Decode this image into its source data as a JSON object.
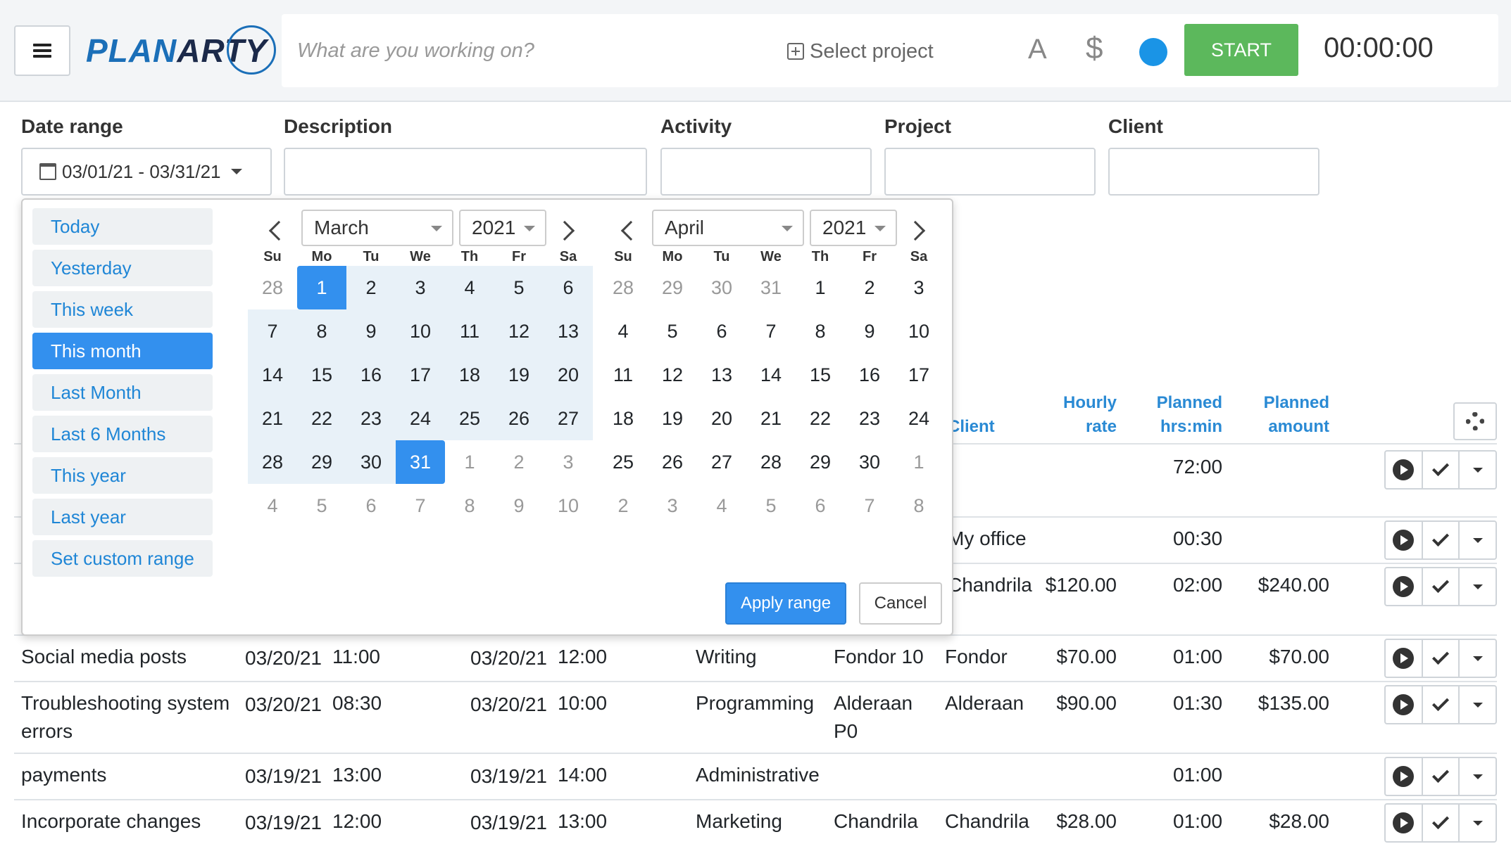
{
  "header": {
    "logo_text_1": "PLAN",
    "logo_text_2": "ARTY",
    "description_placeholder": "What are you working on?",
    "select_project": "Select project",
    "tag_icon": "A",
    "billable_icon": "$",
    "start_label": "START",
    "timer": "00:00:00"
  },
  "filters": {
    "date_range_label": "Date range",
    "date_range_value": "03/01/21 - 03/31/21",
    "description_label": "Description",
    "activity_label": "Activity",
    "project_label": "Project",
    "client_label": "Client"
  },
  "picker": {
    "ranges": [
      "Today",
      "Yesterday",
      "This week",
      "This month",
      "Last Month",
      "Last 6 Months",
      "This year",
      "Last year",
      "Set custom range"
    ],
    "active_range": "This month",
    "left_month": "March",
    "left_year": "2021",
    "right_month": "April",
    "right_year": "2021",
    "weekdays": [
      "Su",
      "Mo",
      "Tu",
      "We",
      "Th",
      "Fr",
      "Sa"
    ],
    "left_days": [
      "28",
      "1",
      "2",
      "3",
      "4",
      "5",
      "6",
      "7",
      "8",
      "9",
      "10",
      "11",
      "12",
      "13",
      "14",
      "15",
      "16",
      "17",
      "18",
      "19",
      "20",
      "21",
      "22",
      "23",
      "24",
      "25",
      "26",
      "27",
      "28",
      "29",
      "30",
      "31",
      "1",
      "2",
      "3",
      "4",
      "5",
      "6",
      "7",
      "8",
      "9",
      "10"
    ],
    "right_days": [
      "28",
      "29",
      "30",
      "31",
      "1",
      "2",
      "3",
      "4",
      "5",
      "6",
      "7",
      "8",
      "9",
      "10",
      "11",
      "12",
      "13",
      "14",
      "15",
      "16",
      "17",
      "18",
      "19",
      "20",
      "21",
      "22",
      "23",
      "24",
      "25",
      "26",
      "27",
      "28",
      "29",
      "30",
      "1",
      "2",
      "3",
      "4",
      "5",
      "6",
      "7",
      "8"
    ],
    "apply_label": "Apply range",
    "cancel_label": "Cancel"
  },
  "table": {
    "headers": {
      "client": "Client",
      "hourly_rate_1": "Hourly",
      "hourly_rate_2": "rate",
      "planned_hrs_1": "Planned",
      "planned_hrs_2": "hrs:min",
      "planned_amount_1": "Planned",
      "planned_amount_2": "amount"
    },
    "partial_rows": [
      {
        "client": "",
        "rate": "",
        "hrs": "72:00",
        "amount": ""
      },
      {
        "client": "My office",
        "rate": "",
        "hrs": "00:30",
        "amount": ""
      },
      {
        "client": "Chandrila",
        "rate": "$120.00",
        "hrs": "02:00",
        "amount": "$240.00"
      }
    ],
    "rows": [
      {
        "description": "Social media posts",
        "start_date": "03/20/21",
        "start_time": "11:00",
        "end_date": "03/20/21",
        "end_time": "12:00",
        "activity": "Writing",
        "project": "Fondor 10",
        "client": "Fondor",
        "rate": "$70.00",
        "hrs": "01:00",
        "amount": "$70.00"
      },
      {
        "description": "Troubleshooting system",
        "description_2": "errors",
        "start_date": "03/20/21",
        "start_time": "08:30",
        "end_date": "03/20/21",
        "end_time": "10:00",
        "activity": "Programming",
        "project": "Alderaan",
        "project_2": "P0",
        "client": "Alderaan",
        "rate": "$90.00",
        "hrs": "01:30",
        "amount": "$135.00"
      },
      {
        "description": "payments",
        "start_date": "03/19/21",
        "start_time": "13:00",
        "end_date": "03/19/21",
        "end_time": "14:00",
        "activity": "Administrative",
        "project": "",
        "client": "",
        "rate": "",
        "hrs": "01:00",
        "amount": ""
      },
      {
        "description": "Incorporate changes",
        "start_date": "03/19/21",
        "start_time": "12:00",
        "end_date": "03/19/21",
        "end_time": "13:00",
        "activity": "Marketing",
        "project": "Chandrila",
        "client": "Chandrila",
        "rate": "$28.00",
        "hrs": "01:00",
        "amount": "$28.00"
      }
    ]
  },
  "colors": {
    "accent": "#3390ee",
    "start_green": "#5cb85c",
    "header_link": "#2a8ad4",
    "range_highlight": "#e8f1f8"
  }
}
